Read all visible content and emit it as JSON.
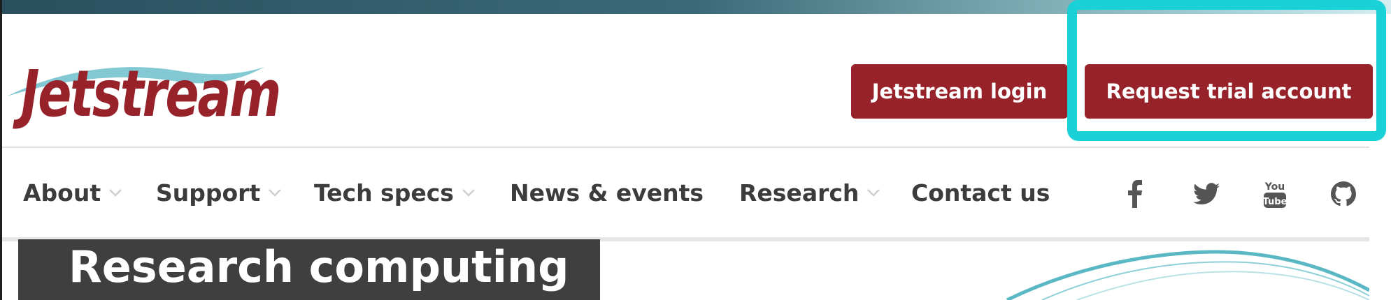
{
  "brand": {
    "logo_text": "Jetstream",
    "color": "#98222a",
    "swoosh_color": "#5ab7c4"
  },
  "header": {
    "login_button": "Jetstream login",
    "trial_button": "Request trial account",
    "button_color": "#98222a",
    "highlight_color": "#1ad1d8"
  },
  "nav": {
    "items": [
      {
        "label": "About",
        "has_dropdown": true
      },
      {
        "label": "Support",
        "has_dropdown": true
      },
      {
        "label": "Tech specs",
        "has_dropdown": true
      },
      {
        "label": "News & events",
        "has_dropdown": false
      },
      {
        "label": "Research",
        "has_dropdown": true
      },
      {
        "label": "Contact us",
        "has_dropdown": false
      }
    ],
    "social": [
      "facebook-icon",
      "twitter-icon",
      "youtube-icon",
      "github-icon"
    ]
  },
  "hero": {
    "title": "Research computing"
  }
}
